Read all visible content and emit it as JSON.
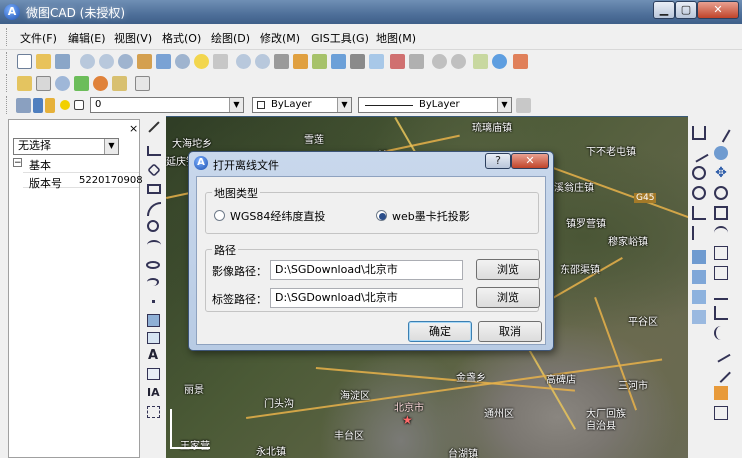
{
  "window": {
    "title": "微图CAD (未授权)",
    "min": "▁",
    "max": "▢",
    "close": "✕"
  },
  "menu": [
    "文件(F)",
    "编辑(E)",
    "视图(V)",
    "格式(O)",
    "绘图(D)",
    "修改(M)",
    "GIS工具(G)",
    "地图(M)"
  ],
  "layerbar": {
    "layer": "0",
    "color": "ByLayer",
    "linetype": "ByLayer"
  },
  "panel": {
    "close": "×",
    "selection": "无选择",
    "section": "基本",
    "prop_name": "版本号",
    "prop_value": "5220170908"
  },
  "map_labels": [
    "大海坨乡",
    "雪莲",
    "琉璃庙镇",
    "下不老屯镇",
    "延庆镇",
    "镇",
    "溪翁庄镇",
    "穆家峪镇",
    "G45",
    "镇罗营镇",
    "东邵渠镇",
    "平谷区",
    "金盏乡",
    "高碑店",
    "三河市",
    "丽景",
    "门头沟",
    "海淀区",
    "北京市",
    "通州区",
    "大厂回族自治县",
    "丰台区",
    "王家营",
    "永北镇",
    "台湖镇"
  ],
  "dialog": {
    "title": "打开离线文件",
    "help": "?",
    "close": "✕",
    "group1_title": "地图类型",
    "radio1": "WGS84经纬度直投",
    "radio2": "web墨卡托投影",
    "group2_title": "路径",
    "image_path_label": "影像路径：",
    "image_path_value": "D:\\SGDownload\\北京市",
    "label_path_label": "标签路径：",
    "label_path_value": "D:\\SGDownload\\北京市",
    "browse": "浏览",
    "ok": "确定",
    "cancel": "取消"
  },
  "left_tools": [
    "line-icon",
    "polyline-icon",
    "polygon-icon",
    "rectangle-icon",
    "arc-icon",
    "circle-icon",
    "spline-icon",
    "ellipse-icon",
    "ellipse-arc-icon",
    "point-icon",
    "block-icon",
    "insert-icon",
    "hatch-icon",
    "text-icon",
    "table-icon",
    "mtext-icon"
  ]
}
